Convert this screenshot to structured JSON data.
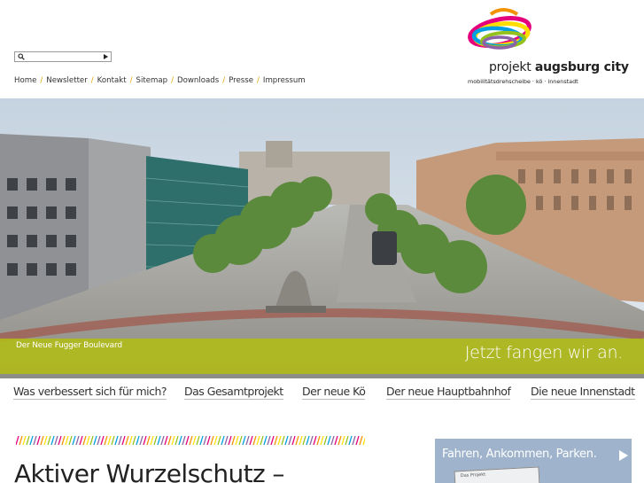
{
  "search": {
    "value": "",
    "placeholder": ""
  },
  "topnav": {
    "items": [
      "Home",
      "Newsletter",
      "Kontakt",
      "Sitemap",
      "Downloads",
      "Presse",
      "Impressum"
    ],
    "separator": "/"
  },
  "logo": {
    "prefix": "projekt",
    "brand": "augsburg city",
    "tagline": "mobilitätsdrehscheibe · kö · innenstadt"
  },
  "hero": {
    "caption": "Der Neue Fugger Boulevard",
    "claim": "Jetzt fangen wir an."
  },
  "mainnav": {
    "items": [
      "Was verbessert sich für mich?",
      "Das Gesamtprojekt",
      "Der neue Kö",
      "Der neue Hauptbahnhof",
      "Die neue Innenstadt"
    ]
  },
  "article": {
    "headline": "Aktiver Wurzelschutz –"
  },
  "promo": {
    "label": "Fahren, Ankommen, Parken.",
    "sign_text": "Das Projekt"
  },
  "colors": {
    "accent": "#b2bc16",
    "separator": "#e2a400",
    "promo_bg": "#9fb4cc",
    "stripes": [
      "#e4007d",
      "#f39200",
      "#ffdd00",
      "#95c11f",
      "#009fe3",
      "#8b62a8"
    ]
  },
  "icons": {
    "search": "magnifier-icon",
    "go": "play-arrow-icon",
    "promo_arrow": "play-arrow-icon"
  }
}
